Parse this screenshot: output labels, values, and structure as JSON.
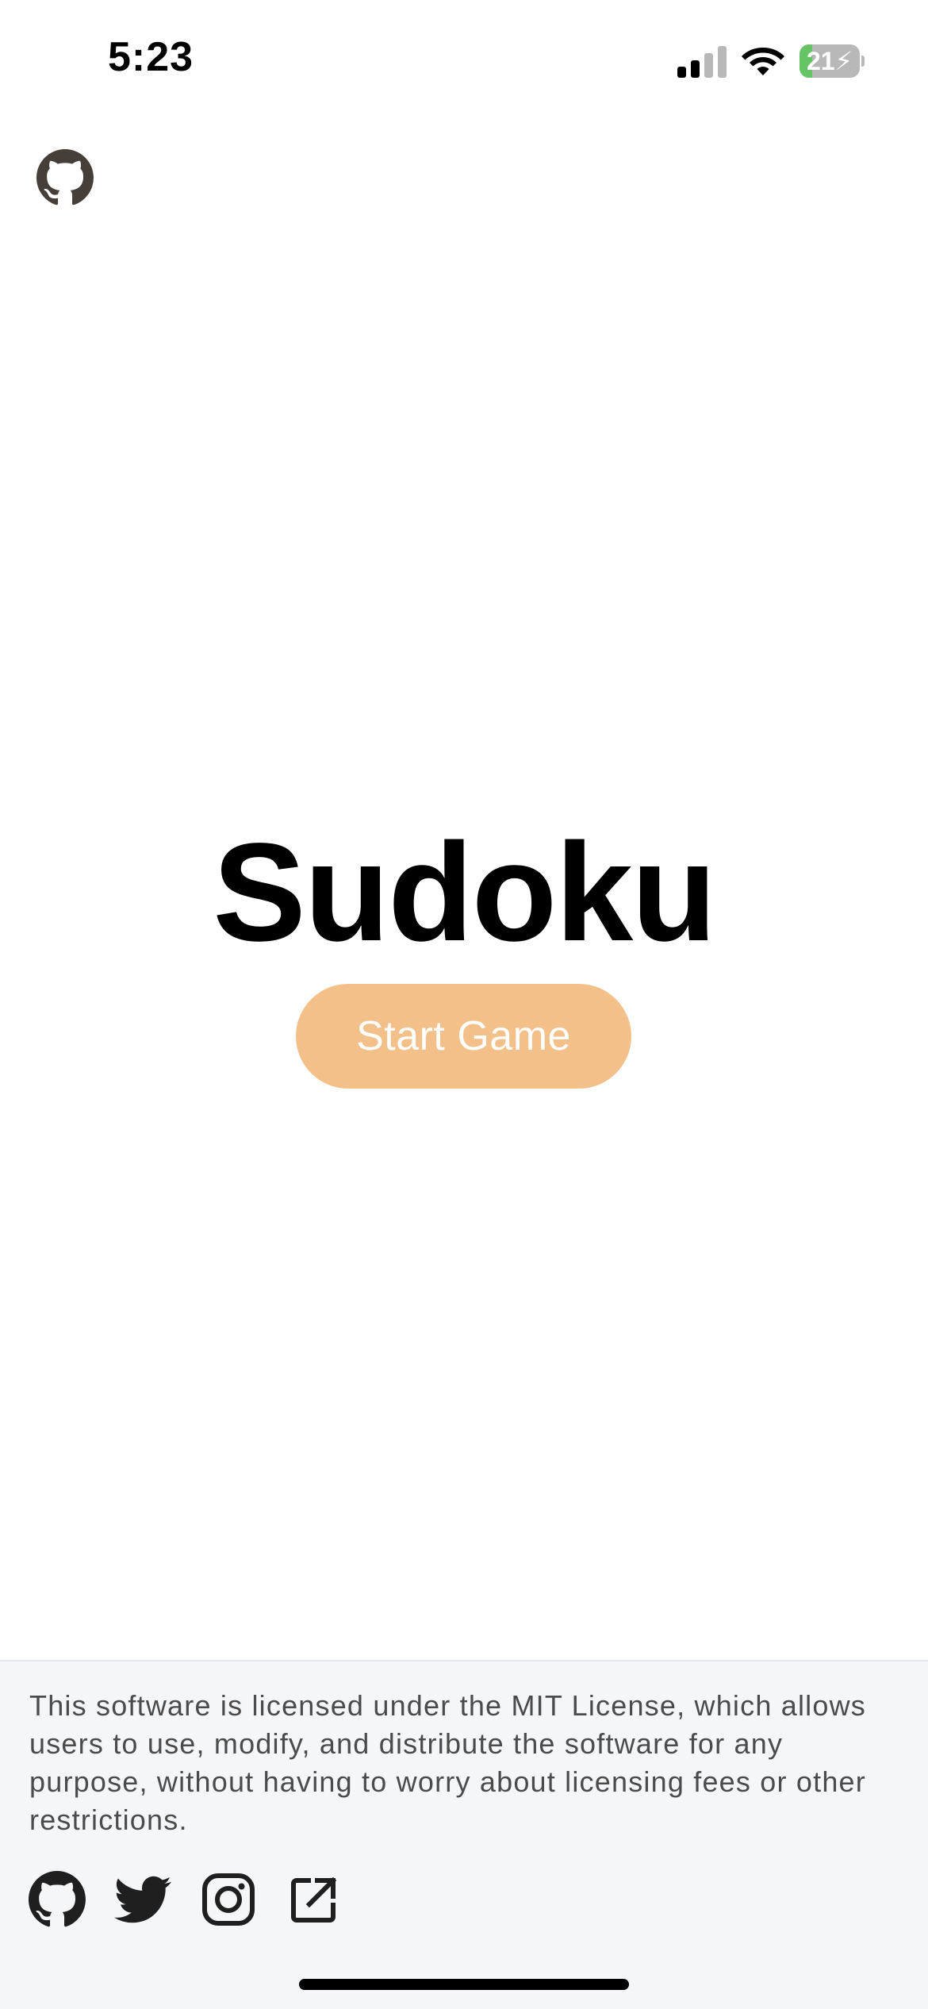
{
  "status_bar": {
    "time": "5:23",
    "battery_percent": "21",
    "battery_level": 0.21,
    "signal_bars": 2,
    "signal_max": 4,
    "icons": [
      "signal-icon",
      "wifi-icon",
      "battery-charging-icon"
    ]
  },
  "header": {
    "github_icon": "github-icon"
  },
  "hero": {
    "title": "Sudoku",
    "start_label": "Start Game"
  },
  "footer": {
    "license": "This software is licensed under the MIT License, which allows users to use, modify, and distribute the software for any purpose, without having to worry about licensing fees or other restrictions.",
    "social_icons": [
      "github-icon",
      "twitter-icon",
      "instagram-icon",
      "external-link-icon"
    ]
  },
  "colors": {
    "accent": "#f3c089",
    "footer_bg": "#f5f6f8",
    "battery_fill": "#65c466",
    "header_icon": "#463f39"
  }
}
